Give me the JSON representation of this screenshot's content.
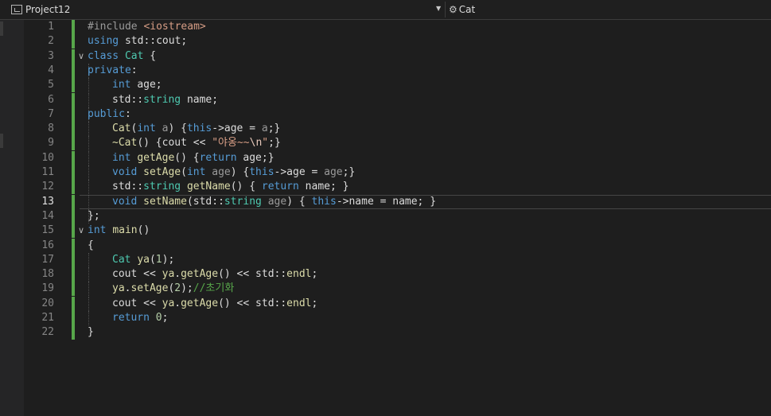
{
  "navbar": {
    "project": "Project12",
    "class_scope": "Cat"
  },
  "editor": {
    "current_line": 13,
    "lines": [
      {
        "n": "1",
        "fold": "",
        "indent": 0,
        "tokens": [
          [
            "pre",
            "#include "
          ],
          [
            "inc",
            "<iostream>"
          ]
        ]
      },
      {
        "n": "2",
        "fold": "",
        "indent": 0,
        "tokens": [
          [
            "kw",
            "using "
          ],
          [
            "def",
            "std::cout;"
          ]
        ]
      },
      {
        "n": "3",
        "fold": "v",
        "indent": 0,
        "tokens": [
          [
            "kw",
            "class "
          ],
          [
            "type",
            "Cat "
          ],
          [
            "def",
            "{"
          ]
        ]
      },
      {
        "n": "4",
        "fold": "",
        "indent": 0,
        "tokens": [
          [
            "kw",
            "private"
          ],
          [
            "def",
            ":"
          ]
        ]
      },
      {
        "n": "5",
        "fold": "",
        "indent": 1,
        "tokens": [
          [
            "kw",
            "int "
          ],
          [
            "def",
            "age;"
          ]
        ]
      },
      {
        "n": "6",
        "fold": "",
        "indent": 1,
        "tokens": [
          [
            "def",
            "std::"
          ],
          [
            "type",
            "string "
          ],
          [
            "def",
            "name;"
          ]
        ]
      },
      {
        "n": "7",
        "fold": "",
        "indent": 0,
        "tokens": [
          [
            "kw",
            "public"
          ],
          [
            "def",
            ":"
          ]
        ]
      },
      {
        "n": "8",
        "fold": "",
        "indent": 1,
        "tokens": [
          [
            "fn",
            "Cat"
          ],
          [
            "def",
            "("
          ],
          [
            "kw",
            "int "
          ],
          [
            "par",
            "a"
          ],
          [
            "def",
            ") {"
          ],
          [
            "kw",
            "this"
          ],
          [
            "def",
            "->age = "
          ],
          [
            "par",
            "a"
          ],
          [
            "def",
            ";}"
          ]
        ]
      },
      {
        "n": "9",
        "fold": "",
        "indent": 1,
        "tokens": [
          [
            "fn",
            "~Cat"
          ],
          [
            "def",
            "() {cout << "
          ],
          [
            "str",
            "\"야옹~~"
          ],
          [
            "esc",
            "\\n"
          ],
          [
            "str",
            "\""
          ],
          [
            "def",
            ";}"
          ]
        ]
      },
      {
        "n": "10",
        "fold": "",
        "indent": 1,
        "tokens": [
          [
            "kw",
            "int "
          ],
          [
            "fn",
            "getAge"
          ],
          [
            "def",
            "() {"
          ],
          [
            "kw",
            "return "
          ],
          [
            "def",
            "age;}"
          ]
        ]
      },
      {
        "n": "11",
        "fold": "",
        "indent": 1,
        "tokens": [
          [
            "kw",
            "void "
          ],
          [
            "fn",
            "setAge"
          ],
          [
            "def",
            "("
          ],
          [
            "kw",
            "int "
          ],
          [
            "par",
            "age"
          ],
          [
            "def",
            ") {"
          ],
          [
            "kw",
            "this"
          ],
          [
            "def",
            "->age = "
          ],
          [
            "par",
            "age"
          ],
          [
            "def",
            ";}"
          ]
        ]
      },
      {
        "n": "12",
        "fold": "",
        "indent": 1,
        "tokens": [
          [
            "def",
            "std::"
          ],
          [
            "type",
            "string "
          ],
          [
            "fn",
            "getName"
          ],
          [
            "def",
            "() { "
          ],
          [
            "kw",
            "return "
          ],
          [
            "def",
            "name; }"
          ]
        ]
      },
      {
        "n": "13",
        "fold": "",
        "indent": 1,
        "tokens": [
          [
            "kw",
            "void "
          ],
          [
            "fn",
            "setName"
          ],
          [
            "def",
            "(std::"
          ],
          [
            "type",
            "string "
          ],
          [
            "par",
            "age"
          ],
          [
            "def",
            ") { "
          ],
          [
            "kw",
            "this"
          ],
          [
            "def",
            "->name = name; }"
          ]
        ]
      },
      {
        "n": "14",
        "fold": "",
        "indent": 0,
        "tokens": [
          [
            "def",
            "};"
          ]
        ]
      },
      {
        "n": "15",
        "fold": "v",
        "indent": 0,
        "tokens": [
          [
            "kw",
            "int "
          ],
          [
            "fn",
            "main"
          ],
          [
            "def",
            "()"
          ]
        ]
      },
      {
        "n": "16",
        "fold": "",
        "indent": 0,
        "tokens": [
          [
            "def",
            "{"
          ]
        ]
      },
      {
        "n": "17",
        "fold": "",
        "indent": 1,
        "tokens": [
          [
            "type",
            "Cat "
          ],
          [
            "fn",
            "ya"
          ],
          [
            "def",
            "("
          ],
          [
            "num",
            "1"
          ],
          [
            "def",
            ");"
          ]
        ]
      },
      {
        "n": "18",
        "fold": "",
        "indent": 1,
        "tokens": [
          [
            "def",
            "cout << "
          ],
          [
            "fn",
            "ya"
          ],
          [
            "def",
            "."
          ],
          [
            "fn",
            "getAge"
          ],
          [
            "def",
            "() << std::"
          ],
          [
            "fn",
            "endl"
          ],
          [
            "def",
            ";"
          ]
        ]
      },
      {
        "n": "19",
        "fold": "",
        "indent": 1,
        "tokens": [
          [
            "fn",
            "ya"
          ],
          [
            "def",
            "."
          ],
          [
            "fn",
            "setAge"
          ],
          [
            "def",
            "("
          ],
          [
            "num",
            "2"
          ],
          [
            "def",
            ");"
          ],
          [
            "cm",
            "//초기화"
          ]
        ]
      },
      {
        "n": "20",
        "fold": "",
        "indent": 1,
        "tokens": [
          [
            "def",
            "cout << "
          ],
          [
            "fn",
            "ya"
          ],
          [
            "def",
            "."
          ],
          [
            "fn",
            "getAge"
          ],
          [
            "def",
            "() << std::"
          ],
          [
            "fn",
            "endl"
          ],
          [
            "def",
            ";"
          ]
        ]
      },
      {
        "n": "21",
        "fold": "",
        "indent": 1,
        "tokens": [
          [
            "kw",
            "return "
          ],
          [
            "num",
            "0"
          ],
          [
            "def",
            ";"
          ]
        ]
      },
      {
        "n": "22",
        "fold": "",
        "indent": 0,
        "tokens": [
          [
            "def",
            "}"
          ]
        ]
      }
    ]
  }
}
